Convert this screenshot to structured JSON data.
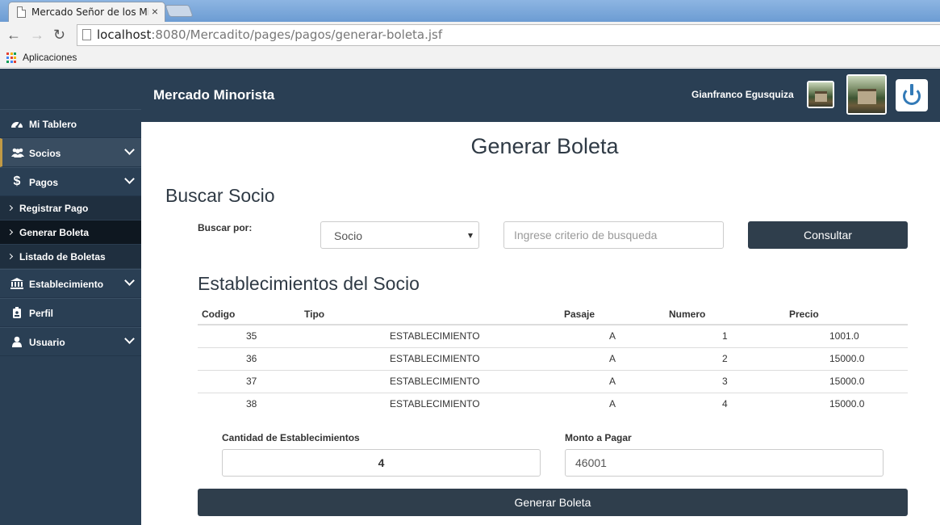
{
  "browser": {
    "tab_title": "Mercado Señor de los Mil",
    "tab_close": "×",
    "url_host": "localhost",
    "url_rest": ":8080/Mercadito/pages/pagos/generar-boleta.jsf",
    "bookmarks_label": "Aplicaciones",
    "apps_colors": [
      "#e34133",
      "#f4b400",
      "#0f9d58",
      "#4285f4",
      "#e34133",
      "#f4b400",
      "#0f9d58",
      "#4285f4",
      "#e34133"
    ]
  },
  "header": {
    "brand": "Mercado Minorista",
    "user_first": "Gianfranco",
    "user_last": "Egusquiza"
  },
  "sidebar": {
    "items": [
      {
        "label": "Mi Tablero",
        "icon": "dashboard-icon"
      },
      {
        "label": "Socios",
        "icon": "users-icon"
      },
      {
        "label": "Pagos",
        "icon": "dollar-icon"
      },
      {
        "label": "Establecimiento",
        "icon": "bank-icon"
      },
      {
        "label": "Perfil",
        "icon": "id-badge-icon"
      },
      {
        "label": "Usuario",
        "icon": "user-icon"
      }
    ],
    "pagos_sub": [
      {
        "label": "Registrar Pago"
      },
      {
        "label": "Generar Boleta"
      },
      {
        "label": "Listado de Boletas"
      }
    ]
  },
  "main": {
    "page_title": "Generar Boleta",
    "section_title": "Buscar Socio",
    "search_label": "Buscar por:",
    "search_select_value": "Socio",
    "search_placeholder": "Ingrese criterio de busqueda",
    "consult_label": "Consultar",
    "table_title": "Establecimientos del Socio",
    "table": {
      "headers": [
        "Codigo",
        "Tipo",
        "Pasaje",
        "Numero",
        "Precio"
      ],
      "rows": [
        [
          "35",
          "ESTABLECIMIENTO",
          "A",
          "1",
          "1001.0"
        ],
        [
          "36",
          "ESTABLECIMIENTO",
          "A",
          "2",
          "15000.0"
        ],
        [
          "37",
          "ESTABLECIMIENTO",
          "A",
          "3",
          "15000.0"
        ],
        [
          "38",
          "ESTABLECIMIENTO",
          "A",
          "4",
          "15000.0"
        ]
      ]
    },
    "cantidad_label": "Cantidad de Establecimientos",
    "cantidad_value": "4",
    "monto_label": "Monto a Pagar",
    "monto_value": "46001",
    "generate_label": "Generar Boleta"
  }
}
